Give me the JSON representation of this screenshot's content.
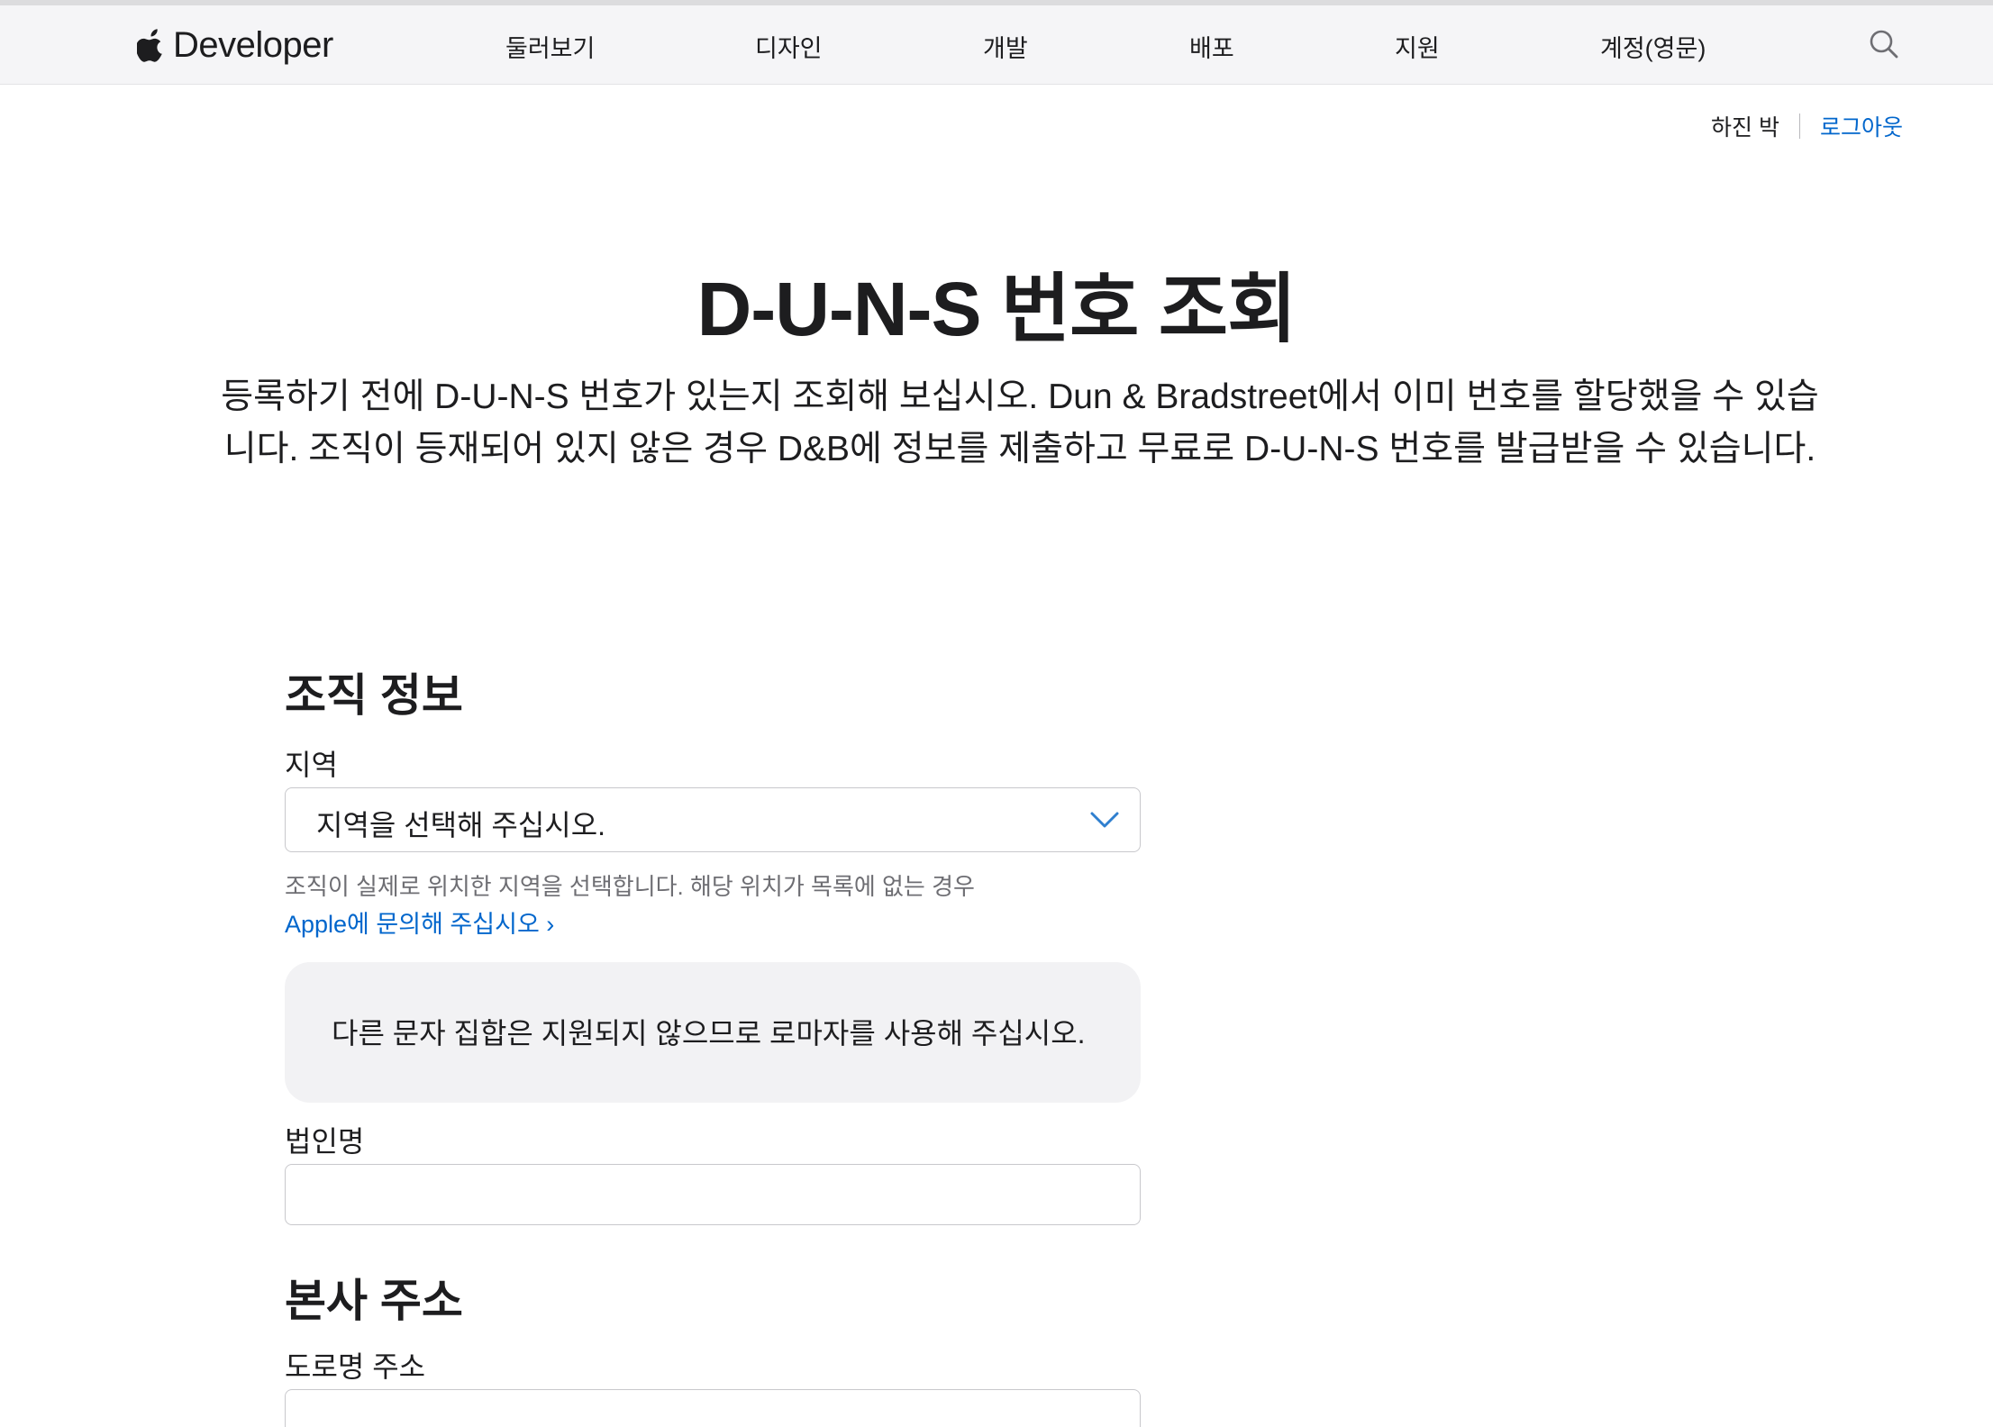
{
  "nav": {
    "brand": "Developer",
    "items": [
      {
        "label": "둘러보기"
      },
      {
        "label": "디자인"
      },
      {
        "label": "개발"
      },
      {
        "label": "배포"
      },
      {
        "label": "지원"
      },
      {
        "label": "계정(영문)"
      }
    ],
    "search_icon": "search-icon",
    "logo_icon": "apple-logo-icon"
  },
  "account": {
    "user_name": "하진 박",
    "logout_label": "로그아웃"
  },
  "page": {
    "title": "D-U-N-S 번호 조회",
    "intro": "등록하기 전에 D-U-N-S 번호가 있는지 조회해 보십시오. Dun & Bradstreet에서 이미 번호를 할당했을 수 있습니다. 조직이 등재되어 있지 않은 경우 D&B에 정보를 제출하고 무료로 D-U-N-S 번호를 발급받을 수 있습니다."
  },
  "form": {
    "org_section": {
      "heading": "조직 정보",
      "region_label": "지역",
      "region_select_value": "지역을 선택해 주십시오.",
      "region_help": "조직이 실제로 위치한 지역을 선택합니다. 해당 위치가 목록에 없는 경우",
      "region_help_link": "Apple에 문의해 주십시오 ›",
      "notice": "다른 문자 집합은 지원되지 않으므로 로마자를 사용해 주십시오.",
      "legal_name_label": "법인명",
      "legal_name_value": ""
    },
    "hq_section": {
      "heading": "본사 주소",
      "street_label": "도로명 주소",
      "street_value": ""
    }
  },
  "colors": {
    "link": "#0066cc",
    "nav_background": "#f5f5f7",
    "notice_background": "#f2f2f4",
    "chevron": "#2f7fcf"
  }
}
